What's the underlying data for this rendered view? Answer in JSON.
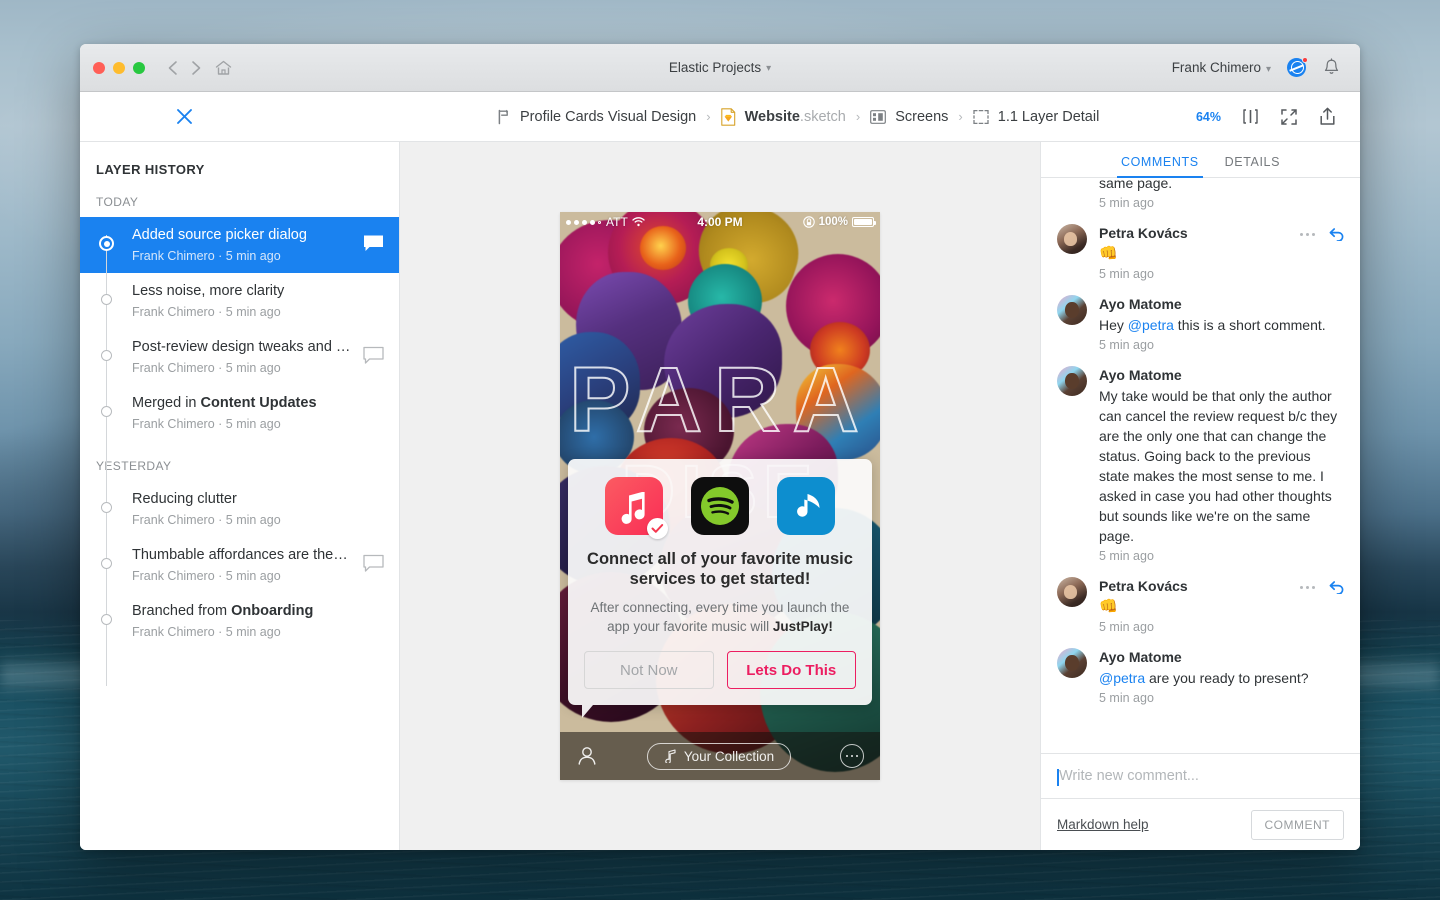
{
  "window": {
    "title": "Elastic Projects",
    "user": "Frank Chimero"
  },
  "toolbar": {
    "breadcrumb": [
      {
        "label": "Profile Cards Visual Design",
        "icon": "branch-icon"
      },
      {
        "label": "Website",
        "ext": ".sketch",
        "icon": "sketch-file-icon"
      },
      {
        "label": "Screens",
        "icon": "artboard-grid-icon"
      },
      {
        "label": "1.1 Layer Detail",
        "icon": "layer-bounds-icon"
      }
    ],
    "separator": "›",
    "zoom": "64%",
    "tools": [
      "compare-icon",
      "fullscreen-icon",
      "share-icon"
    ]
  },
  "sidebar": {
    "title": "LAYER HISTORY",
    "groups": [
      {
        "label": "TODAY",
        "items": [
          {
            "title": "Added source picker dialog",
            "title_bold": "",
            "meta": "Frank Chimero · 5 min ago",
            "selected": true,
            "has_comment": true
          },
          {
            "title": "Less noise, more clarity",
            "title_bold": "",
            "meta": "Frank Chimero · 5 min ago",
            "selected": false,
            "has_comment": false
          },
          {
            "title": "Post-review design tweaks and …",
            "title_bold": "",
            "meta": "Frank Chimero · 5 min ago",
            "selected": false,
            "has_comment": true
          },
          {
            "title": "Merged in ",
            "title_bold": "Content Updates",
            "meta": "Frank Chimero · 5 min ago",
            "selected": false,
            "has_comment": false
          }
        ]
      },
      {
        "label": "YESTERDAY",
        "items": [
          {
            "title": "Reducing clutter",
            "title_bold": "",
            "meta": "Frank Chimero · 5 min ago",
            "selected": false,
            "has_comment": false
          },
          {
            "title": "Thumbable affordances are the…",
            "title_bold": "",
            "meta": "Frank Chimero · 5 min ago",
            "selected": false,
            "has_comment": true
          },
          {
            "title": "Branched from ",
            "title_bold": "Onboarding",
            "meta": "Frank Chimero · 5 min ago",
            "selected": false,
            "has_comment": false
          }
        ]
      }
    ]
  },
  "canvas": {
    "phone": {
      "status_bar": {
        "carrier": "ATT",
        "time": "4:00 PM",
        "battery": "100%"
      },
      "artwork_text_line1": "PARA",
      "artwork_text_line2": "DISE",
      "dialog": {
        "services": [
          "apple-music-icon",
          "spotify-icon",
          "rdio-icon"
        ],
        "selected_service": "apple-music-icon",
        "headline": "Connect all of your favorite music services to get started!",
        "body_before": "After connecting, every time you launch the app your favorite music will ",
        "body_bold": "JustPlay!",
        "secondary_button": "Not Now",
        "primary_button": "Lets Do This",
        "primary_color": "#ec1e61"
      },
      "tab_bar": {
        "profile": "person-icon",
        "collection": "Your Collection",
        "more": "more-icon"
      }
    }
  },
  "comments": {
    "tabs": [
      {
        "label": "COMMENTS",
        "active": true
      },
      {
        "label": "DETAILS",
        "active": false
      }
    ],
    "items": [
      {
        "author": "",
        "avatar": "",
        "clipped": true,
        "text": "thoughts but sounds like we're on the same page.",
        "time": "5 min ago",
        "has_actions": false
      },
      {
        "author": "Petra Kovács",
        "avatar": "petra",
        "clipped": false,
        "emoji": "👊",
        "text": "",
        "time": "5 min ago",
        "has_actions": true
      },
      {
        "author": "Ayo Matome",
        "avatar": "ayo",
        "clipped": false,
        "text_before": "Hey ",
        "mention": "@petra",
        "text_after": " this is a short comment.",
        "time": "5 min ago",
        "has_actions": false
      },
      {
        "author": "Ayo Matome",
        "avatar": "ayo",
        "clipped": false,
        "text": "My take would be that only the author can cancel the review request b/c they are the only one that can change the status. Going back to the previous state makes the most sense to me. I asked in case you had other thoughts but sounds like we're on the same page.",
        "time": "5 min ago",
        "has_actions": false
      },
      {
        "author": "Petra Kovács",
        "avatar": "petra",
        "clipped": false,
        "emoji": "👊",
        "text": "",
        "time": "5 min ago",
        "has_actions": true
      },
      {
        "author": "Ayo Matome",
        "avatar": "ayo",
        "clipped": false,
        "text_before": "",
        "mention": "@petra",
        "text_after": " are you ready to present?",
        "time": "5 min ago",
        "has_actions": false
      }
    ],
    "input_placeholder": "Write new comment...",
    "markdown_help": "Markdown help",
    "submit_button": "COMMENT"
  },
  "colors": {
    "accent": "#1a82f0",
    "selected_row": "#1a82f0",
    "muted": "#9a9ea1",
    "pink": "#ec1e61"
  }
}
